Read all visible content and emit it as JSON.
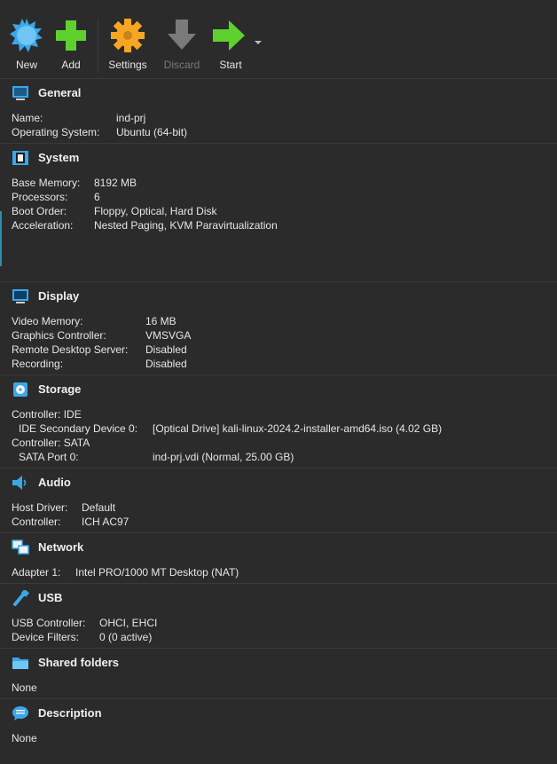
{
  "toolbar": {
    "new_label": "New",
    "add_label": "Add",
    "settings_label": "Settings",
    "discard_label": "Discard",
    "start_label": "Start"
  },
  "general": {
    "title": "General",
    "rows": [
      {
        "k": "Name:",
        "v": "ind-prj"
      },
      {
        "k": "Operating System:",
        "v": "Ubuntu (64-bit)"
      }
    ]
  },
  "system": {
    "title": "System",
    "rows": [
      {
        "k": "Base Memory:",
        "v": "8192 MB"
      },
      {
        "k": "Processors:",
        "v": "6"
      },
      {
        "k": "Boot Order:",
        "v": "Floppy, Optical, Hard Disk"
      },
      {
        "k": "Acceleration:",
        "v": "Nested Paging, KVM Paravirtualization"
      }
    ]
  },
  "display": {
    "title": "Display",
    "rows": [
      {
        "k": "Video Memory:",
        "v": "16 MB"
      },
      {
        "k": "Graphics Controller:",
        "v": "VMSVGA"
      },
      {
        "k": "Remote Desktop Server:",
        "v": "Disabled"
      },
      {
        "k": "Recording:",
        "v": "Disabled"
      }
    ]
  },
  "storage": {
    "title": "Storage",
    "rows": [
      {
        "k": "Controller: IDE",
        "v": ""
      },
      {
        "k": " IDE Secondary Device 0:",
        "v": "[Optical Drive] kali-linux-2024.2-installer-amd64.iso (4.02 GB)"
      },
      {
        "k": "Controller: SATA",
        "v": ""
      },
      {
        "k": " SATA Port 0:",
        "v": "ind-prj.vdi (Normal, 25.00 GB)"
      }
    ]
  },
  "audio": {
    "title": "Audio",
    "rows": [
      {
        "k": "Host Driver:",
        "v": "Default"
      },
      {
        "k": "Controller:",
        "v": "ICH AC97"
      }
    ]
  },
  "network": {
    "title": "Network",
    "rows": [
      {
        "k": "Adapter 1:",
        "v": "Intel PRO/1000 MT Desktop (NAT)"
      }
    ]
  },
  "usb": {
    "title": "USB",
    "rows": [
      {
        "k": "USB Controller:",
        "v": "OHCI, EHCI"
      },
      {
        "k": "Device Filters:",
        "v": "0 (0 active)"
      }
    ]
  },
  "shared": {
    "title": "Shared folders",
    "rows": [
      {
        "k": "None",
        "v": ""
      }
    ]
  },
  "description": {
    "title": "Description",
    "rows": [
      {
        "k": "None",
        "v": ""
      }
    ]
  }
}
